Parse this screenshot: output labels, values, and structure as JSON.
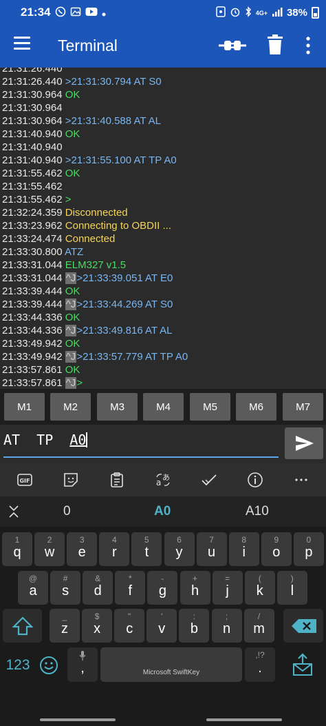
{
  "status_bar": {
    "time": "21:34",
    "battery": "38%",
    "network": "4G+"
  },
  "app_bar": {
    "title": "Terminal"
  },
  "terminal": {
    "lines": [
      [
        {
          "t": "21:31:26.440",
          "c": "ts"
        }
      ],
      [
        {
          "t": "21:31:26.440 ",
          "c": "ts"
        },
        {
          "t": ">21:31:30.794 AT S0",
          "c": "c-blue"
        }
      ],
      [
        {
          "t": "21:31:30.964 ",
          "c": "ts"
        },
        {
          "t": "OK",
          "c": "c-green"
        }
      ],
      [
        {
          "t": "21:31:30.964",
          "c": "ts"
        }
      ],
      [
        {
          "t": "21:31:30.964 ",
          "c": "ts"
        },
        {
          "t": ">21:31:40.588 AT AL",
          "c": "c-blue"
        }
      ],
      [
        {
          "t": "21:31:40.940 ",
          "c": "ts"
        },
        {
          "t": "OK",
          "c": "c-green"
        }
      ],
      [
        {
          "t": "21:31:40.940",
          "c": "ts"
        }
      ],
      [
        {
          "t": "21:31:40.940 ",
          "c": "ts"
        },
        {
          "t": ">21:31:55.100 AT TP A0",
          "c": "c-blue"
        }
      ],
      [
        {
          "t": "21:31:55.462 ",
          "c": "ts"
        },
        {
          "t": "OK",
          "c": "c-green"
        }
      ],
      [
        {
          "t": "21:31:55.462",
          "c": "ts"
        }
      ],
      [
        {
          "t": "21:31:55.462 ",
          "c": "ts"
        },
        {
          "t": ">",
          "c": "c-green"
        }
      ],
      [
        {
          "t": "21:32:24.359 ",
          "c": "ts"
        },
        {
          "t": "Disconnected",
          "c": "c-yellow"
        }
      ],
      [
        {
          "t": "21:33:23.962 ",
          "c": "ts"
        },
        {
          "t": "Connecting to OBDII ...",
          "c": "c-yellow"
        }
      ],
      [
        {
          "t": "21:33:24.474 ",
          "c": "ts"
        },
        {
          "t": "Connected",
          "c": "c-yellow"
        }
      ],
      [
        {
          "t": "21:33:30.800 ",
          "c": "ts"
        },
        {
          "t": "ATZ",
          "c": "c-blue"
        }
      ],
      [
        {
          "t": "21:33:31.044 ",
          "c": "ts"
        },
        {
          "t": "ELM327 v1.5",
          "c": "c-green"
        }
      ],
      [
        {
          "t": "21:33:31.044 ",
          "c": "ts"
        },
        {
          "t": "^J",
          "c": "ctrl"
        },
        {
          "t": ">21:33:39.051 AT E0",
          "c": "c-blue"
        }
      ],
      [
        {
          "t": "21:33:39.444 ",
          "c": "ts"
        },
        {
          "t": "OK",
          "c": "c-green"
        }
      ],
      [
        {
          "t": "21:33:39.444 ",
          "c": "ts"
        },
        {
          "t": "^J",
          "c": "ctrl"
        },
        {
          "t": ">21:33:44.269 AT S0",
          "c": "c-blue"
        }
      ],
      [
        {
          "t": "21:33:44.336 ",
          "c": "ts"
        },
        {
          "t": "OK",
          "c": "c-green"
        }
      ],
      [
        {
          "t": "21:33:44.336 ",
          "c": "ts"
        },
        {
          "t": "^J",
          "c": "ctrl"
        },
        {
          "t": ">21:33:49.816 AT AL",
          "c": "c-blue"
        }
      ],
      [
        {
          "t": "21:33:49.942 ",
          "c": "ts"
        },
        {
          "t": "OK",
          "c": "c-green"
        }
      ],
      [
        {
          "t": "21:33:49.942 ",
          "c": "ts"
        },
        {
          "t": "^J",
          "c": "ctrl"
        },
        {
          "t": ">21:33:57.779 AT TP A0",
          "c": "c-blue"
        }
      ],
      [
        {
          "t": "21:33:57.861 ",
          "c": "ts"
        },
        {
          "t": "OK",
          "c": "c-green"
        }
      ],
      [
        {
          "t": "21:33:57.861 ",
          "c": "ts"
        },
        {
          "t": "^J",
          "c": "ctrl"
        },
        {
          "t": ">",
          "c": "c-green"
        }
      ]
    ]
  },
  "macros": [
    "M1",
    "M2",
    "M3",
    "M4",
    "M5",
    "M6",
    "M7"
  ],
  "input": {
    "prefix": "AT  TP  ",
    "underlined": "A0"
  },
  "keyboard": {
    "toolbar": [
      "gif-icon",
      "sticker-icon",
      "clipboard-icon",
      "translate-icon",
      "checkmark-icon",
      "info-icon",
      "more-horizontal-icon"
    ],
    "suggestions": [
      "0",
      "A0",
      "A10"
    ],
    "row1": [
      [
        "q",
        "1"
      ],
      [
        "w",
        "2"
      ],
      [
        "e",
        "3"
      ],
      [
        "r",
        "4"
      ],
      [
        "t",
        "5"
      ],
      [
        "y",
        "6"
      ],
      [
        "u",
        "7"
      ],
      [
        "i",
        "8"
      ],
      [
        "o",
        "9"
      ],
      [
        "p",
        "0"
      ]
    ],
    "row2": [
      [
        "a",
        "@"
      ],
      [
        "s",
        "#"
      ],
      [
        "d",
        "&"
      ],
      [
        "f",
        "*"
      ],
      [
        "g",
        "-"
      ],
      [
        "h",
        "+"
      ],
      [
        "j",
        "="
      ],
      [
        "k",
        "("
      ],
      [
        "l",
        ")"
      ]
    ],
    "row3": [
      [
        "z",
        "_"
      ],
      [
        "x",
        "$"
      ],
      [
        "c",
        "\""
      ],
      [
        "v",
        "'"
      ],
      [
        "b",
        ":"
      ],
      [
        "n",
        ";"
      ],
      [
        "m",
        "/"
      ]
    ],
    "num_key": "123",
    "space_label": "Microsoft SwiftKey",
    "period": ".",
    "period_sub": ",!?",
    "comma": ","
  }
}
